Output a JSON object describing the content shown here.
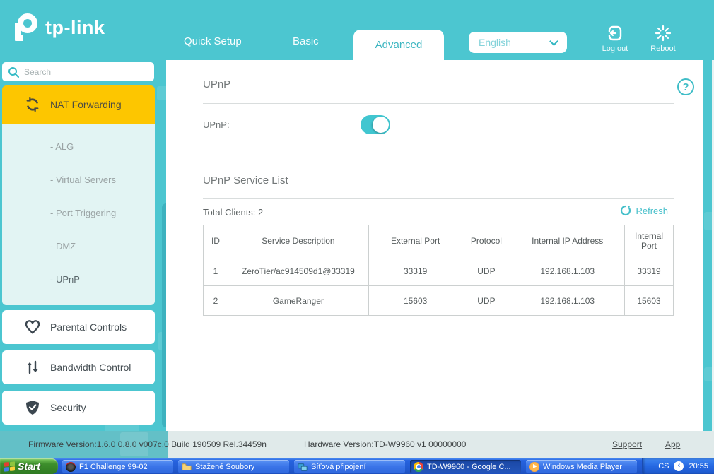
{
  "header": {
    "logo_text": "tp-link",
    "tabs": [
      {
        "label": "Quick Setup",
        "active": false
      },
      {
        "label": "Basic",
        "active": false
      },
      {
        "label": "Advanced",
        "active": true
      }
    ],
    "language": {
      "value": "English"
    },
    "logout_label": "Log out",
    "reboot_label": "Reboot"
  },
  "sidebar": {
    "search_placeholder": "Search",
    "nat": {
      "label": "NAT Forwarding",
      "subitems": [
        {
          "label": "- ALG",
          "selected": false
        },
        {
          "label": "- Virtual Servers",
          "selected": false
        },
        {
          "label": "- Port Triggering",
          "selected": false
        },
        {
          "label": "- DMZ",
          "selected": false
        },
        {
          "label": "- UPnP",
          "selected": true
        }
      ]
    },
    "items": [
      {
        "label": "Parental Controls",
        "icon": "heart-icon"
      },
      {
        "label": "Bandwidth Control",
        "icon": "arrows-up-down-icon"
      },
      {
        "label": "Security",
        "icon": "shield-check-icon"
      }
    ]
  },
  "main": {
    "section_upnp_title": "UPnP",
    "upnp_field_label": "UPnP:",
    "upnp_enabled": true,
    "section_list_title": "UPnP Service List",
    "total_clients": "Total Clients: 2",
    "refresh_label": "Refresh",
    "table": {
      "headers": [
        "ID",
        "Service Description",
        "External Port",
        "Protocol",
        "Internal IP Address",
        "Internal Port"
      ],
      "rows": [
        [
          "1",
          "ZeroTier/ac914509d1@33319",
          "33319",
          "UDP",
          "192.168.1.103",
          "33319"
        ],
        [
          "2",
          "GameRanger",
          "15603",
          "UDP",
          "192.168.1.103",
          "15603"
        ]
      ]
    }
  },
  "footer": {
    "firmware": "Firmware Version:1.6.0 0.8.0 v007c.0 Build 190509 Rel.34459n",
    "hardware": "Hardware Version:TD-W9960 v1 00000000",
    "support_label": "Support",
    "app_label": "App"
  },
  "taskbar": {
    "start_label": "Start",
    "buttons": [
      {
        "label": "F1 Challenge 99-02",
        "icon": "f1-game-icon",
        "active": false
      },
      {
        "label": "Stažené Soubory",
        "icon": "folder-icon",
        "active": false
      },
      {
        "label": "Síťová připojení",
        "icon": "network-connections-icon",
        "active": false
      },
      {
        "label": "TD-W9960 - Google C...",
        "icon": "chrome-icon",
        "active": true
      },
      {
        "label": "Windows Media Player",
        "icon": "media-player-icon",
        "active": false
      }
    ],
    "tray": {
      "language": "CS",
      "time": "20:55"
    }
  },
  "colors": {
    "teal": "#4cc6d0",
    "accent_teal": "#3fbdc7",
    "highlight_yellow": "#fdc600",
    "submenu_bg": "#e2f4f3",
    "taskbar_blue": "#2663e0",
    "start_green": "#3d8f2c"
  }
}
